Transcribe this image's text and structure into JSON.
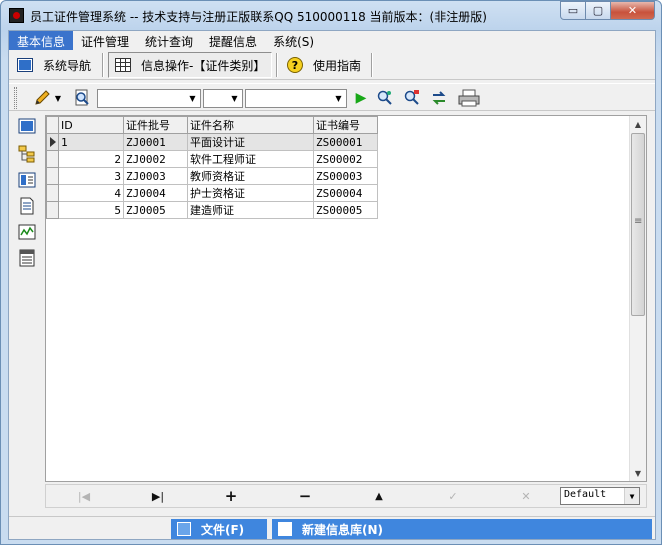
{
  "window": {
    "title": "员工证件管理系统 -- 技术支持与注册正版联系QQ 510000118    当前版本：(非注册版)",
    "min_glyph": "▭",
    "max_glyph": "▢",
    "close_glyph": "✕"
  },
  "menu": {
    "items": [
      {
        "label": "基本信息",
        "active": true
      },
      {
        "label": "证件管理"
      },
      {
        "label": "统计查询"
      },
      {
        "label": "提醒信息"
      },
      {
        "label": "系统(S)"
      }
    ]
  },
  "navtabs": {
    "nav": "系统导航",
    "info": "信息操作-【证件类别】",
    "guide": "使用指南",
    "guide_glyph": "?"
  },
  "toolbar": {
    "combo1": "",
    "combo2": "",
    "combo3": "",
    "combo_arrow": "▼",
    "run_glyph": "▶"
  },
  "grid": {
    "columns": [
      "ID",
      "证件批号",
      "证件名称",
      "证书编号"
    ],
    "rows": [
      {
        "id": "1",
        "batch": "ZJ0001",
        "name": "平面设计证",
        "cert": "ZS00001"
      },
      {
        "id": "2",
        "batch": "ZJ0002",
        "name": "软件工程师证",
        "cert": "ZS00002"
      },
      {
        "id": "3",
        "batch": "ZJ0003",
        "name": "教师资格证",
        "cert": "ZS00003"
      },
      {
        "id": "4",
        "batch": "ZJ0004",
        "name": "护士资格证",
        "cert": "ZS00004"
      },
      {
        "id": "5",
        "batch": "ZJ0005",
        "name": "建造师证",
        "cert": "ZS00005"
      }
    ],
    "scroll_up": "▲",
    "scroll_down": "▼"
  },
  "navigator": {
    "first": "|◀",
    "last": "▶|",
    "insert": "+",
    "delete": "−",
    "up": "▲",
    "post": "✓",
    "cancel": "✕",
    "filter_value": "Default",
    "filter_arrow": "▼"
  },
  "status": {
    "file": "文件(F)",
    "new_db": "新建信息库(N)"
  }
}
